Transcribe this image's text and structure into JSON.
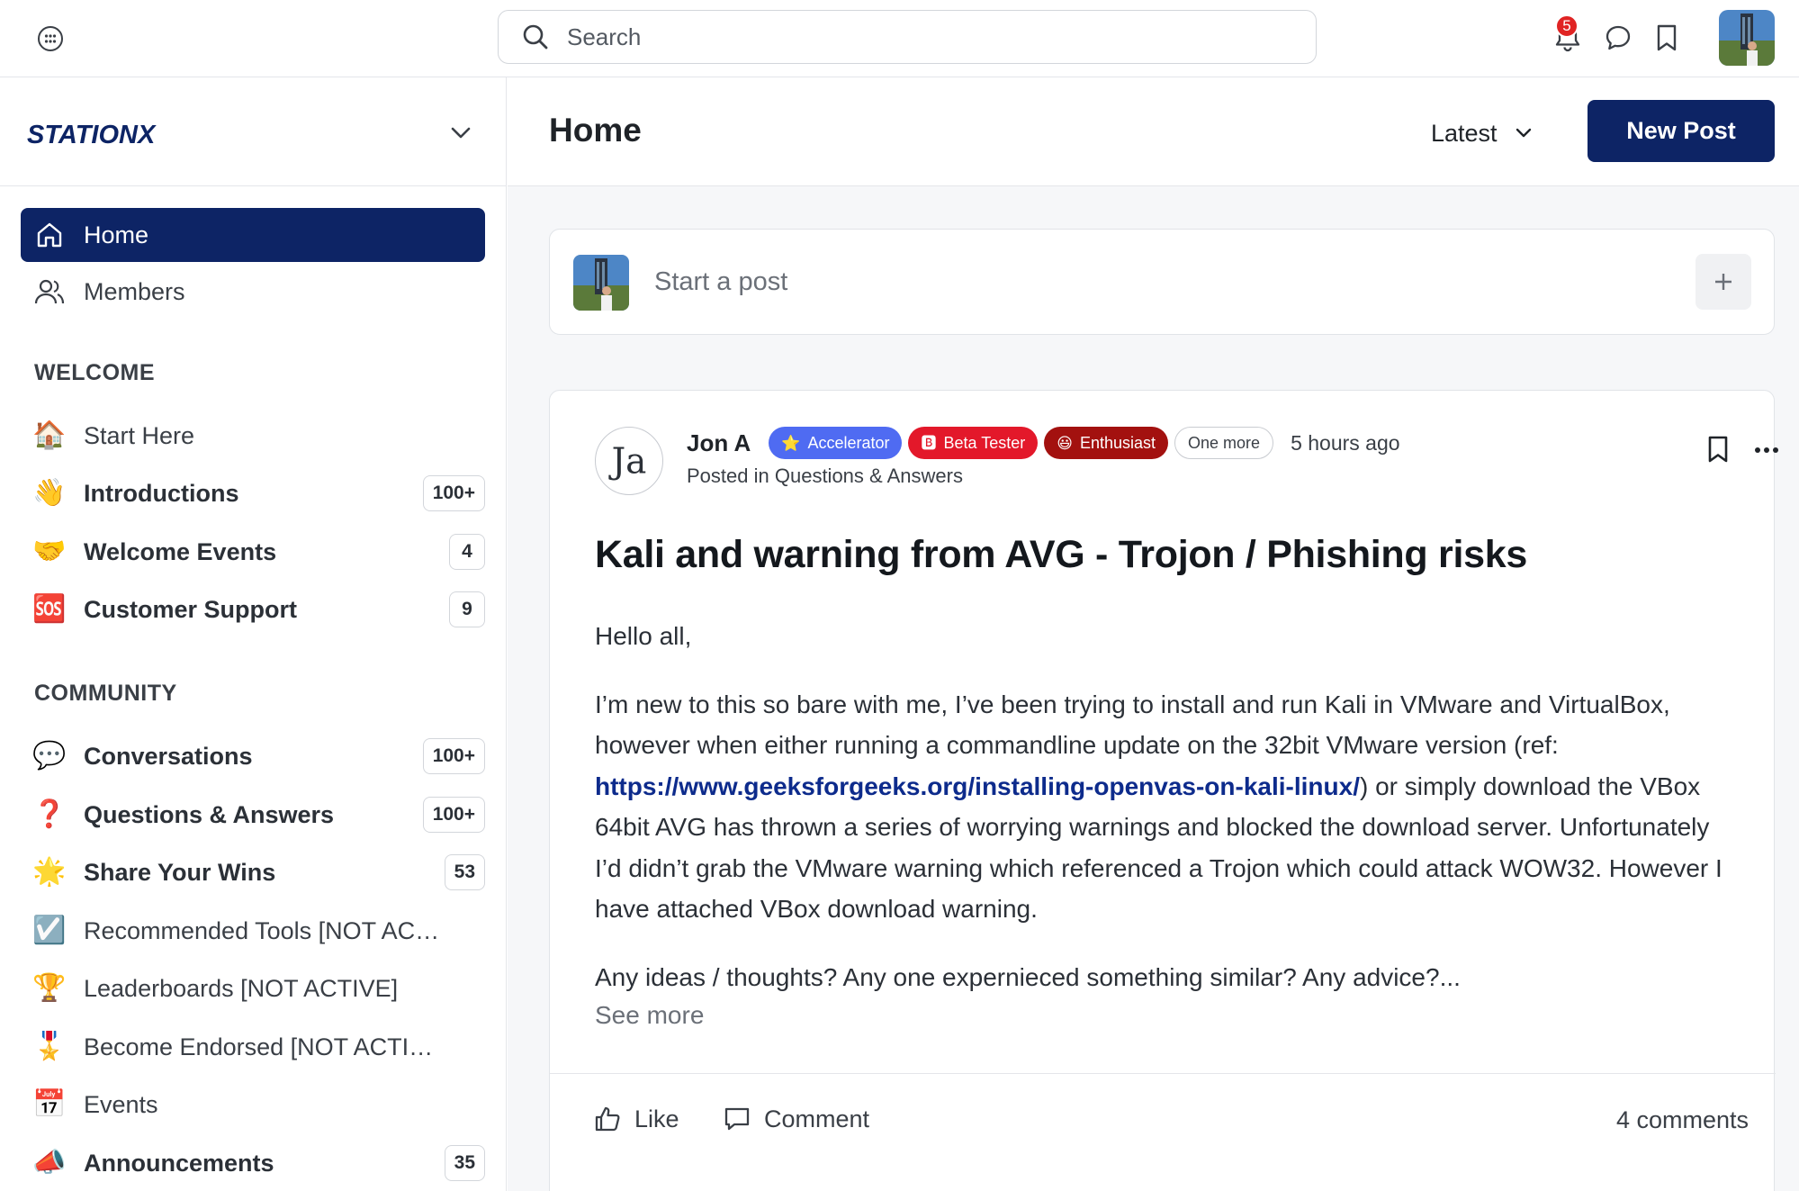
{
  "topbar": {
    "search_placeholder": "Search",
    "notification_count": "5"
  },
  "brand": {
    "name": "STATIONX"
  },
  "sidebar": {
    "primary": [
      {
        "label": "Home",
        "icon": "home-icon",
        "active": true
      },
      {
        "label": "Members",
        "icon": "members-icon",
        "active": false
      }
    ],
    "welcome_heading": "WELCOME",
    "welcome": [
      {
        "label": "Start Here",
        "emoji": "🏠",
        "count": ""
      },
      {
        "label": "Introductions",
        "emoji": "👋",
        "count": "100+"
      },
      {
        "label": "Welcome Events",
        "emoji": "🤝",
        "count": "4"
      },
      {
        "label": "Customer Support",
        "emoji": "🆘",
        "count": "9"
      }
    ],
    "community_heading": "COMMUNITY",
    "community": [
      {
        "label": "Conversations",
        "emoji": "💬",
        "count": "100+"
      },
      {
        "label": "Questions & Answers",
        "emoji": "❓",
        "count": "100+"
      },
      {
        "label": "Share Your Wins",
        "emoji": "🌟",
        "count": "53"
      },
      {
        "label": "Recommended Tools [NOT ACTIV...",
        "emoji": "☑️",
        "count": ""
      },
      {
        "label": "Leaderboards [NOT ACTIVE]",
        "emoji": "🏆",
        "count": ""
      },
      {
        "label": "Become Endorsed [NOT ACTIVE]",
        "emoji": "🎖️",
        "count": ""
      },
      {
        "label": "Events",
        "emoji": "📅",
        "count": ""
      },
      {
        "label": "Announcements",
        "emoji": "📣",
        "count": "35"
      }
    ]
  },
  "main": {
    "title": "Home",
    "sort_label": "Latest",
    "new_post_label": "New Post",
    "composer_placeholder": "Start a post"
  },
  "post": {
    "author": "Jon A",
    "avatar_initials": "Ja",
    "badges": [
      {
        "label": "Accelerator",
        "icon": "⭐",
        "color": "#4f6bf2"
      },
      {
        "label": "Beta Tester",
        "icon": "🅱",
        "color": "#e3182a"
      },
      {
        "label": "Enthusiast",
        "icon": "😃",
        "color": "#a3110f"
      }
    ],
    "more_badges_label": "One more",
    "time": "5 hours ago",
    "posted_in_prefix": "Posted in",
    "space": "Questions & Answers",
    "title": "Kali and warning from AVG - Trojon / Phishing risks",
    "greeting": "Hello all,",
    "paragraph_before_link": "I’m new to this so bare with me, I’ve been trying to install and run Kali in VMware and VirtualBox, however when either running a commandline update on the 32bit VMware version (ref: ",
    "link": "https://www.geeksforgeeks.org/installing-openvas-on-kali-linux/",
    "paragraph_after_link": ") or simply download the VBox 64bit AVG has thrown a series of worrying warnings and blocked the download server. Unfortunately I’d didn’t grab the VMware warning which referenced a Trojon which could attack WOW32. However I have attached VBox download warning.",
    "closing": "Any ideas / thoughts? Any one expernieced something similar? Any advice?...",
    "see_more": "See more",
    "like_label": "Like",
    "comment_label": "Comment",
    "comment_count": "4 comments"
  },
  "colors": {
    "brand_navy": "#0d2465",
    "link": "#0d2b8c",
    "notification_red": "#e02424"
  }
}
